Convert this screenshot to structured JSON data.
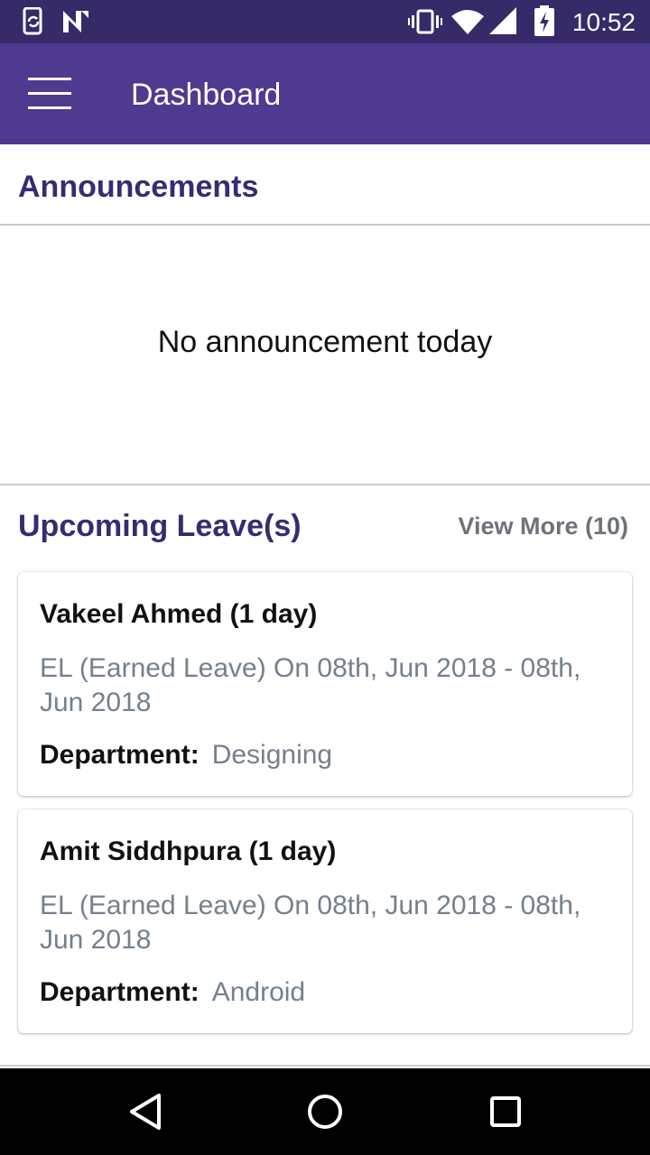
{
  "status_bar": {
    "time": "10:52",
    "left_icons": [
      "phone-sync-icon",
      "n-logo-icon"
    ],
    "right_icons": [
      "vibrate-icon",
      "wifi-icon",
      "signal-icon",
      "battery-charging-icon"
    ]
  },
  "app_bar": {
    "title": "Dashboard",
    "menu_icon": "hamburger-menu-icon"
  },
  "announcements": {
    "heading": "Announcements",
    "empty_message": "No announcement today"
  },
  "upcoming_leaves": {
    "heading": "Upcoming Leave(s)",
    "view_more": "View More (10)",
    "items": [
      {
        "name": "Vakeel Ahmed (1 day)",
        "detail": "EL (Earned Leave) On 08th, Jun 2018 - 08th, Jun 2018",
        "department_label": "Department:",
        "department": "Designing"
      },
      {
        "name": "Amit Siddhpura (1 day)",
        "detail": "EL (Earned Leave) On 08th, Jun 2018 - 08th, Jun 2018",
        "department_label": "Department:",
        "department": "Android"
      }
    ]
  },
  "nav_bar": {
    "buttons": [
      "back-triangle-icon",
      "home-circle-icon",
      "recents-square-icon"
    ]
  },
  "colors": {
    "status_bar": "#362a68",
    "app_bar": "#4e3a8e",
    "heading": "#3a2a72",
    "secondary_text": "#74808d"
  }
}
